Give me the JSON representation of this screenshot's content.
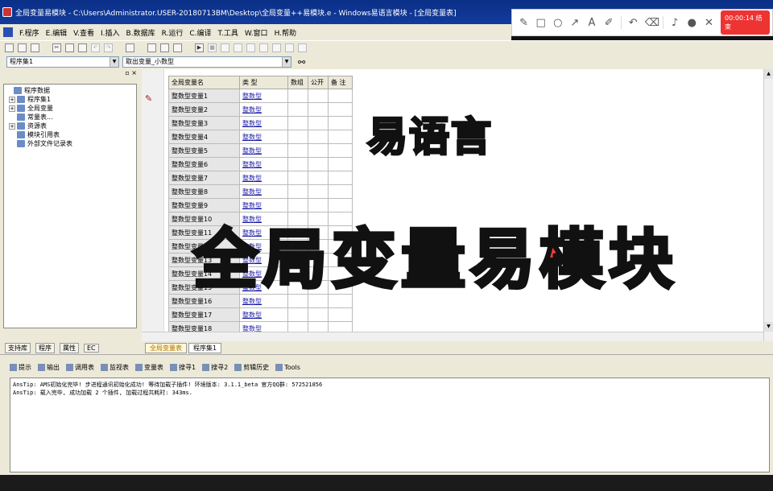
{
  "window": {
    "title": "全局变量易模块 - C:\\Users\\Administrator.USER-20180713BM\\Desktop\\全局变量++易模块.e - Windows易语言模块 - [全局变量表]"
  },
  "recorder": {
    "timer": "00:00:14",
    "stop_label": "结束"
  },
  "menu": [
    "F.程序",
    "E.编辑",
    "V.查看",
    "I.插入",
    "B.数据库",
    "R.运行",
    "C.编译",
    "T.工具",
    "W.窗口",
    "H.帮助"
  ],
  "selectors": {
    "left": "程序集1",
    "right": "取出变量_小数型"
  },
  "left_panel": {
    "pin": "▫ ×",
    "tree": [
      {
        "label": "程序数据",
        "indent": 0,
        "exp": "",
        "icon": "database-icon"
      },
      {
        "label": "程序集1",
        "indent": 1,
        "exp": "+",
        "icon": "module-icon"
      },
      {
        "label": "全局变量",
        "indent": 1,
        "exp": "+",
        "icon": "variable-icon"
      },
      {
        "label": "常量表...",
        "indent": 1,
        "exp": "",
        "icon": "constant-icon"
      },
      {
        "label": "资源表",
        "indent": 1,
        "exp": "+",
        "icon": "resource-icon"
      },
      {
        "label": "模块引用表",
        "indent": 1,
        "exp": "",
        "icon": "reference-icon"
      },
      {
        "label": "外部文件记录表",
        "indent": 1,
        "exp": "",
        "icon": "file-icon"
      }
    ],
    "tabs": [
      "支持库",
      "程序",
      "属性",
      "EC"
    ]
  },
  "table": {
    "headers": [
      "全局变量名",
      "类 型",
      "数组",
      "公开",
      "备 注"
    ],
    "rows": [
      {
        "name": "整数型变量1",
        "type": "整数型"
      },
      {
        "name": "整数型变量2",
        "type": "整数型"
      },
      {
        "name": "整数型变量3",
        "type": "整数型"
      },
      {
        "name": "整数型变量4",
        "type": "整数型"
      },
      {
        "name": "整数型变量5",
        "type": "整数型"
      },
      {
        "name": "整数型变量6",
        "type": "整数型"
      },
      {
        "name": "整数型变量7",
        "type": "整数型"
      },
      {
        "name": "整数型变量8",
        "type": "整数型"
      },
      {
        "name": "整数型变量9",
        "type": "整数型"
      },
      {
        "name": "整数型变量10",
        "type": "整数型"
      },
      {
        "name": "整数型变量11",
        "type": "整数型"
      },
      {
        "name": "整数型变量12",
        "type": "整数型"
      },
      {
        "name": "整数型变量13",
        "type": "整数型"
      },
      {
        "name": "整数型变量14",
        "type": "整数型"
      },
      {
        "name": "整数型变量15",
        "type": "整数型"
      },
      {
        "name": "整数型变量16",
        "type": "整数型"
      },
      {
        "name": "整数型变量17",
        "type": "整数型"
      },
      {
        "name": "整数型变量18",
        "type": "整数型"
      }
    ]
  },
  "overlay": {
    "line1": "易语言",
    "line2": "全局变量易模块"
  },
  "doc_tabs": [
    "全局变量表",
    "程序集1"
  ],
  "bottom_tabs": [
    "提示",
    "输出",
    "调用表",
    "监视表",
    "变量表",
    "搜寻1",
    "搜寻2",
    "剪辑历史",
    "Tools"
  ],
  "output_lines": [
    "AnsTip: AMS初始化完毕!  步进程通讯初始化成功!  等待加载子插件!  环境版本: 3.1.1_beta 官方QQ群: 572521856",
    "AnsTip: 载入完毕, 成功加载 2 个插件, 加载过程共耗时: 343ms."
  ]
}
